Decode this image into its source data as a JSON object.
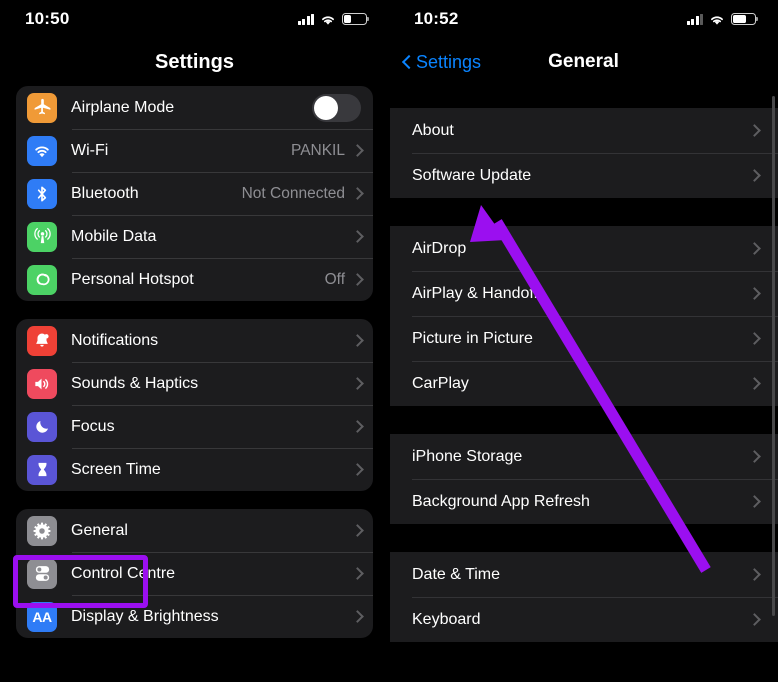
{
  "left_phone": {
    "status_bar": {
      "time": "10:50",
      "signal_icon": "cellular-signal-icon",
      "signal_bars_filled": 4,
      "wifi_icon": "wifi-icon",
      "battery_icon": "battery-icon",
      "battery_percent": 35
    },
    "nav": {
      "title": "Settings"
    },
    "groups": [
      {
        "rows": [
          {
            "label": "Airplane Mode",
            "icon": "airplane-icon",
            "icon_color": "#f09a37",
            "accessory": "toggle",
            "toggle_on": false
          },
          {
            "label": "Wi-Fi",
            "icon": "wifi-icon",
            "icon_color": "#2f7cf6",
            "value": "PANKIL",
            "accessory": "chevron"
          },
          {
            "label": "Bluetooth",
            "icon": "bluetooth-icon",
            "icon_color": "#2f7cf6",
            "value": "Not Connected",
            "accessory": "chevron"
          },
          {
            "label": "Mobile Data",
            "icon": "cellular-antenna-icon",
            "icon_color": "#4cd265",
            "value": "",
            "accessory": "chevron"
          },
          {
            "label": "Personal Hotspot",
            "icon": "hotspot-link-icon",
            "icon_color": "#4cd265",
            "value": "Off",
            "accessory": "chevron"
          }
        ]
      },
      {
        "rows": [
          {
            "label": "Notifications",
            "icon": "bell-icon",
            "icon_color": "#ef4136",
            "value": "",
            "accessory": "chevron"
          },
          {
            "label": "Sounds & Haptics",
            "icon": "speaker-icon",
            "icon_color": "#ef4a5e",
            "value": "",
            "accessory": "chevron"
          },
          {
            "label": "Focus",
            "icon": "moon-icon",
            "icon_color": "#5a55d6",
            "value": "",
            "accessory": "chevron"
          },
          {
            "label": "Screen Time",
            "icon": "hourglass-icon",
            "icon_color": "#5a55d6",
            "value": "",
            "accessory": "chevron"
          }
        ]
      },
      {
        "rows": [
          {
            "label": "General",
            "icon": "gear-icon",
            "icon_color": "#8e8e93",
            "value": "",
            "accessory": "chevron",
            "highlighted": true
          },
          {
            "label": "Control Centre",
            "icon": "control-centre-icon",
            "icon_color": "#8e8e93",
            "value": "",
            "accessory": "chevron"
          },
          {
            "label": "Display & Brightness",
            "icon": "display-brightness-icon",
            "icon_color": "#2f7cf6",
            "value": "",
            "accessory": "chevron"
          }
        ]
      }
    ]
  },
  "right_phone": {
    "status_bar": {
      "time": "10:52",
      "signal_icon": "cellular-signal-icon",
      "signal_bars_filled": 3,
      "wifi_icon": "wifi-icon",
      "battery_icon": "battery-icon",
      "battery_percent": 62
    },
    "nav": {
      "back_label": "Settings",
      "back_icon": "chevron-left-icon",
      "title": "General"
    },
    "groups": [
      {
        "rows": [
          {
            "label": "About",
            "accessory": "chevron"
          },
          {
            "label": "Software Update",
            "accessory": "chevron"
          }
        ]
      },
      {
        "rows": [
          {
            "label": "AirDrop",
            "accessory": "chevron"
          },
          {
            "label": "AirPlay & Handoff",
            "accessory": "chevron"
          },
          {
            "label": "Picture in Picture",
            "accessory": "chevron"
          },
          {
            "label": "CarPlay",
            "accessory": "chevron"
          }
        ]
      },
      {
        "rows": [
          {
            "label": "iPhone Storage",
            "accessory": "chevron"
          },
          {
            "label": "Background App Refresh",
            "accessory": "chevron"
          }
        ]
      },
      {
        "rows": [
          {
            "label": "Date & Time",
            "accessory": "chevron"
          },
          {
            "label": "Keyboard",
            "accessory": "chevron"
          }
        ]
      }
    ]
  },
  "annotations": {
    "arrow_color": "#9b0ff0",
    "highlight_color": "#9b0ff0",
    "arrow_target": "Software Update",
    "highlight_target": "General"
  }
}
